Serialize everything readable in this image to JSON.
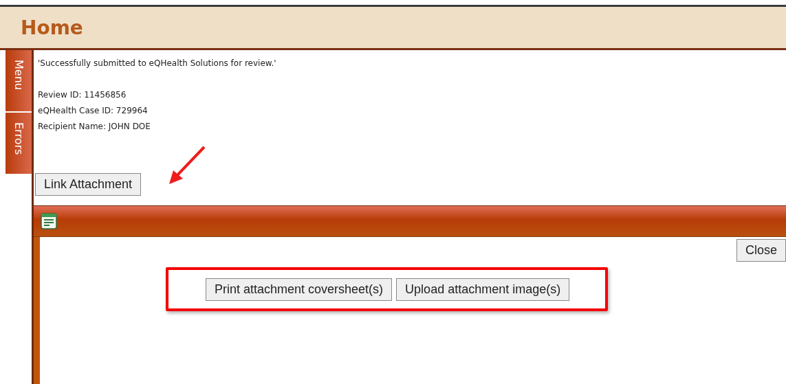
{
  "header": {
    "title": "Home"
  },
  "side_tabs": [
    {
      "label": "Menu"
    },
    {
      "label": "Errors"
    }
  ],
  "message": {
    "status": "'Successfully submitted to eQHealth Solutions for review.'",
    "details": [
      "Review ID: 11456856",
      "eQHealth Case ID: 729964",
      "Recipient Name: JOHN DOE"
    ]
  },
  "link_button": "Link Attachment",
  "dialog": {
    "close_button": "Close",
    "actions": [
      "Print attachment coversheet(s)",
      "Upload attachment image(s)"
    ]
  }
}
